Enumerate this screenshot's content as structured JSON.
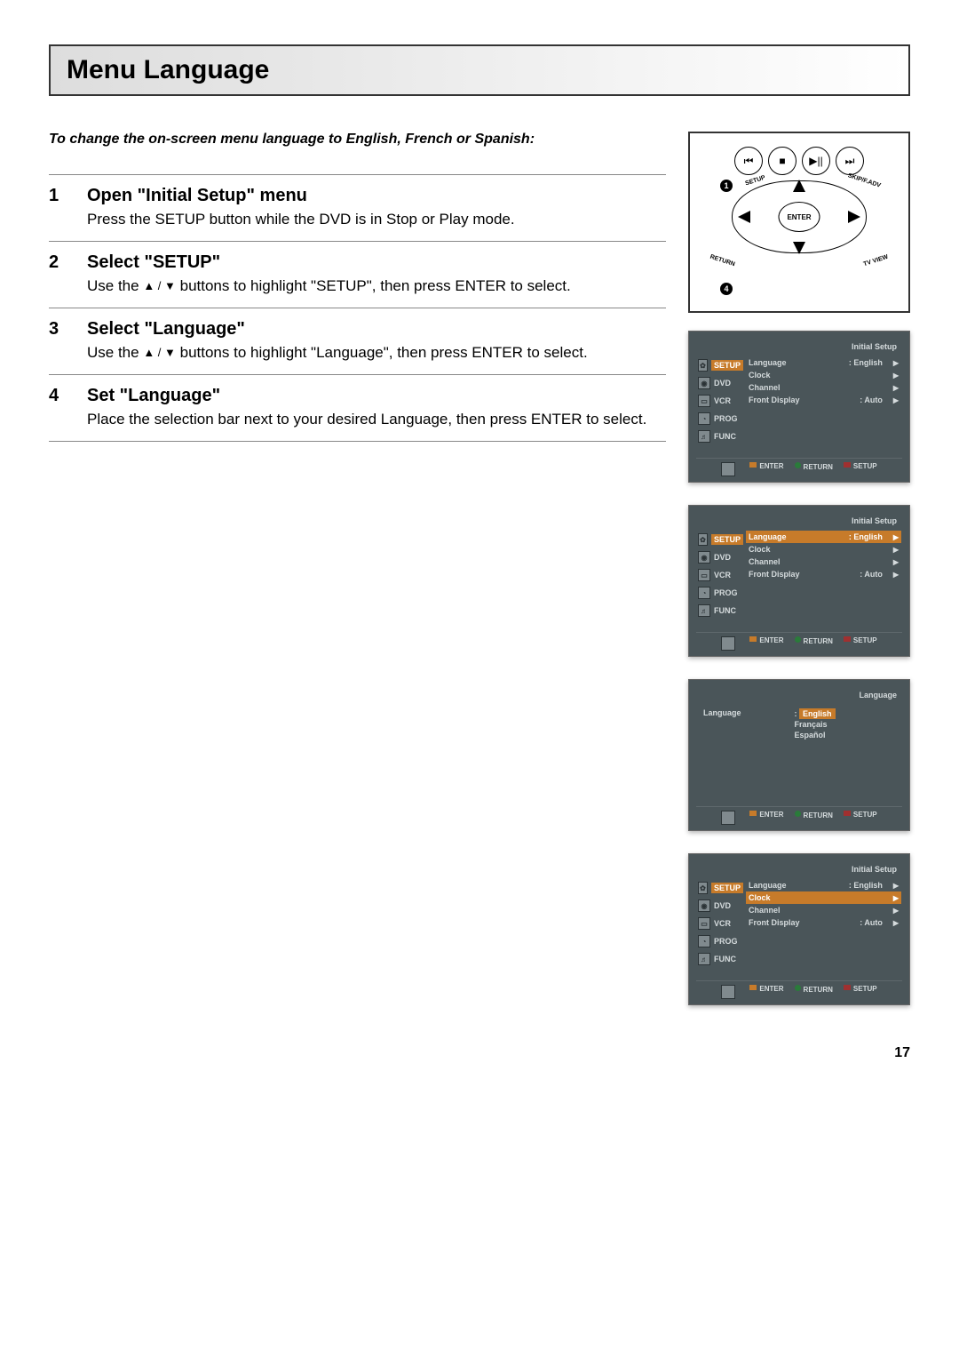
{
  "title": "Menu Language",
  "intro": "To change the on-screen menu language to English, French or Spanish:",
  "steps": [
    {
      "num": "1",
      "title": "Open \"Initial Setup\" menu",
      "body_pre": "Press the SETUP button while the DVD is in Stop or Play mode.",
      "arrows": false,
      "body_post": ""
    },
    {
      "num": "2",
      "title": "Select \"SETUP\"",
      "body_pre": "Use the ",
      "arrows": true,
      "body_post": " buttons to highlight \"SETUP\", then press ENTER to select."
    },
    {
      "num": "3",
      "title": "Select \"Language\"",
      "body_pre": "Use the ",
      "arrows": true,
      "body_post": " buttons to highlight \"Language\", then press ENTER to select."
    },
    {
      "num": "4",
      "title": "Set \"Language\"",
      "body_pre": "Place the selection bar next to your desired Language, then press ENTER to select.",
      "arrows": false,
      "body_post": ""
    }
  ],
  "remote": {
    "setup": "SETUP",
    "skip": "SKIP/F.ADV",
    "return": "RETURN",
    "tvview": "TV VIEW",
    "enter": "ENTER",
    "marker1": "1",
    "marker4": "4"
  },
  "osd_common": {
    "header_initial": "Initial Setup",
    "header_language": "Language",
    "side": {
      "setup": "SETUP",
      "dvd": "DVD",
      "vcr": "VCR",
      "prog": "PROG",
      "func": "FUNC"
    },
    "rows": {
      "language": "Language",
      "clock": "Clock",
      "channel": "Channel",
      "front": "Front Display",
      "val_english": ": English",
      "val_auto": ": Auto",
      "colon": ":"
    },
    "lang_opts": {
      "en": "English",
      "fr": "Français",
      "es": "Español"
    },
    "foot": {
      "enter": "ENTER",
      "return": "RETURN",
      "setup": "SETUP"
    }
  },
  "page_number": "17"
}
